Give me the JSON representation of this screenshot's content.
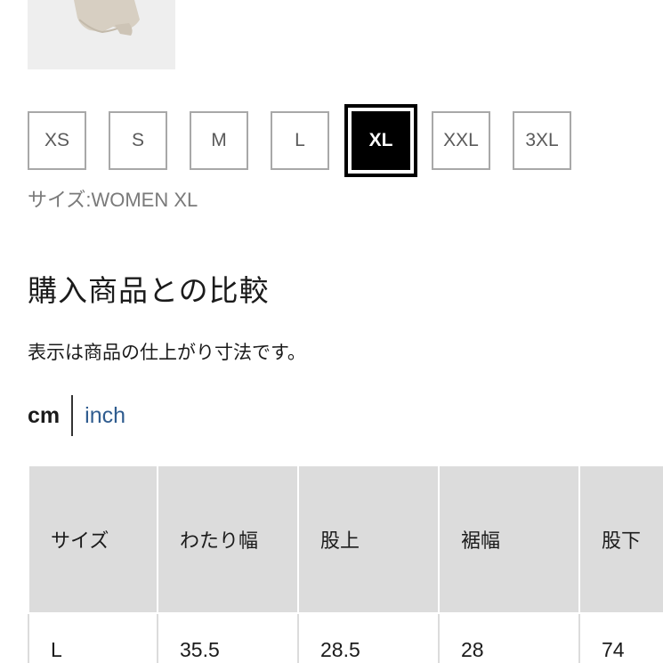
{
  "product": {
    "thumbnail": "product-thumbnail-pants"
  },
  "sizes": {
    "options": [
      "XS",
      "S",
      "M",
      "L",
      "XL",
      "XXL",
      "3XL"
    ],
    "selected": "XL",
    "caption": "サイズ:WOMEN XL"
  },
  "comparison": {
    "title": "購入商品との比較",
    "note": "表示は商品の仕上がり寸法です。",
    "units": {
      "cm": "cm",
      "inch": "inch",
      "active": "cm"
    },
    "table": {
      "headers": [
        "サイズ",
        "わたり幅",
        "股上",
        "裾幅",
        "股下"
      ],
      "rows": [
        [
          "L",
          "35.5",
          "28.5",
          "28",
          "74"
        ]
      ]
    }
  },
  "colors": {
    "chip_border": "#a8a8a8",
    "selected_chip": "#000000",
    "table_header_bg": "#dcdcdc",
    "link": "#2f5c8f"
  }
}
